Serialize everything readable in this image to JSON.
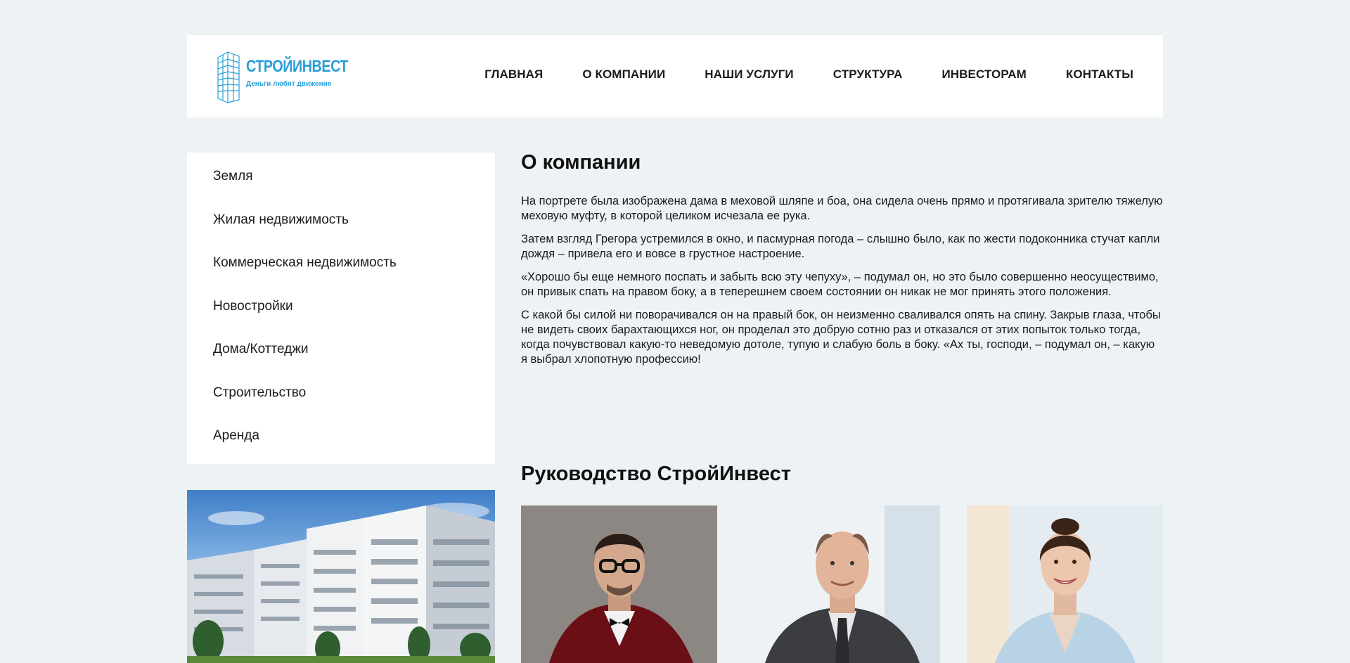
{
  "logo": {
    "name": "СТРОЙИНВЕСТ",
    "slogan": "Деньги любят движение",
    "icon": "building-logo-icon",
    "color": "#2a9fd8"
  },
  "nav": {
    "items": [
      {
        "label": "Главная"
      },
      {
        "label": "О компании"
      },
      {
        "label": "Наши услуги"
      },
      {
        "label": "Структура"
      },
      {
        "label": "Инвесторам"
      },
      {
        "label": "Контакты"
      }
    ]
  },
  "sidebar": {
    "items": [
      {
        "label": "Земля"
      },
      {
        "label": "Жилая недвижимость"
      },
      {
        "label": "Коммерческая недвижимость"
      },
      {
        "label": "Новостройки"
      },
      {
        "label": "Дома/Коттеджи"
      },
      {
        "label": "Строительство"
      },
      {
        "label": "Аренда"
      }
    ]
  },
  "main": {
    "title": "О компании",
    "paragraphs": [
      "На портрете была изображена дама в меховой шляпе и боа, она сидела очень прямо и протягивала зрителю тяжелую меховую муфту, в которой целиком исчезала ее рука.",
      "Затем взгляд Грегора устремился в окно, и пасмурная погода – слышно было, как по жести подоконника стучат капли дождя – привела его и вовсе в грустное настроение.",
      "«Хорошо бы еще немного поспать и забыть всю эту чепуху», – подумал он, но это было совершенно неосуществимо, он привык спать на правом боку, а в теперешнем своем состоянии он никак не мог принять этого положения.",
      "С какой бы силой ни поворачивался он на правый бок, он неизменно сваливался опять на спину. Закрыв глаза, чтобы не видеть своих барахтающихся ног, он проделал это добрую сотню раз и отказался от этих попыток только тогда, когда почувствовал какую-то неведомую дотоле, тупую и слабую боль в боку. «Ах ты, господи, – подумал он, – какую я выбрал хлопотную профессию!"
    ]
  },
  "team": {
    "title": "Руководство СтройИнвест"
  },
  "colors": {
    "background": "#edf2f5",
    "panel": "#ffffff",
    "text": "#1b1b1b",
    "accent": "#2a9fd8"
  }
}
